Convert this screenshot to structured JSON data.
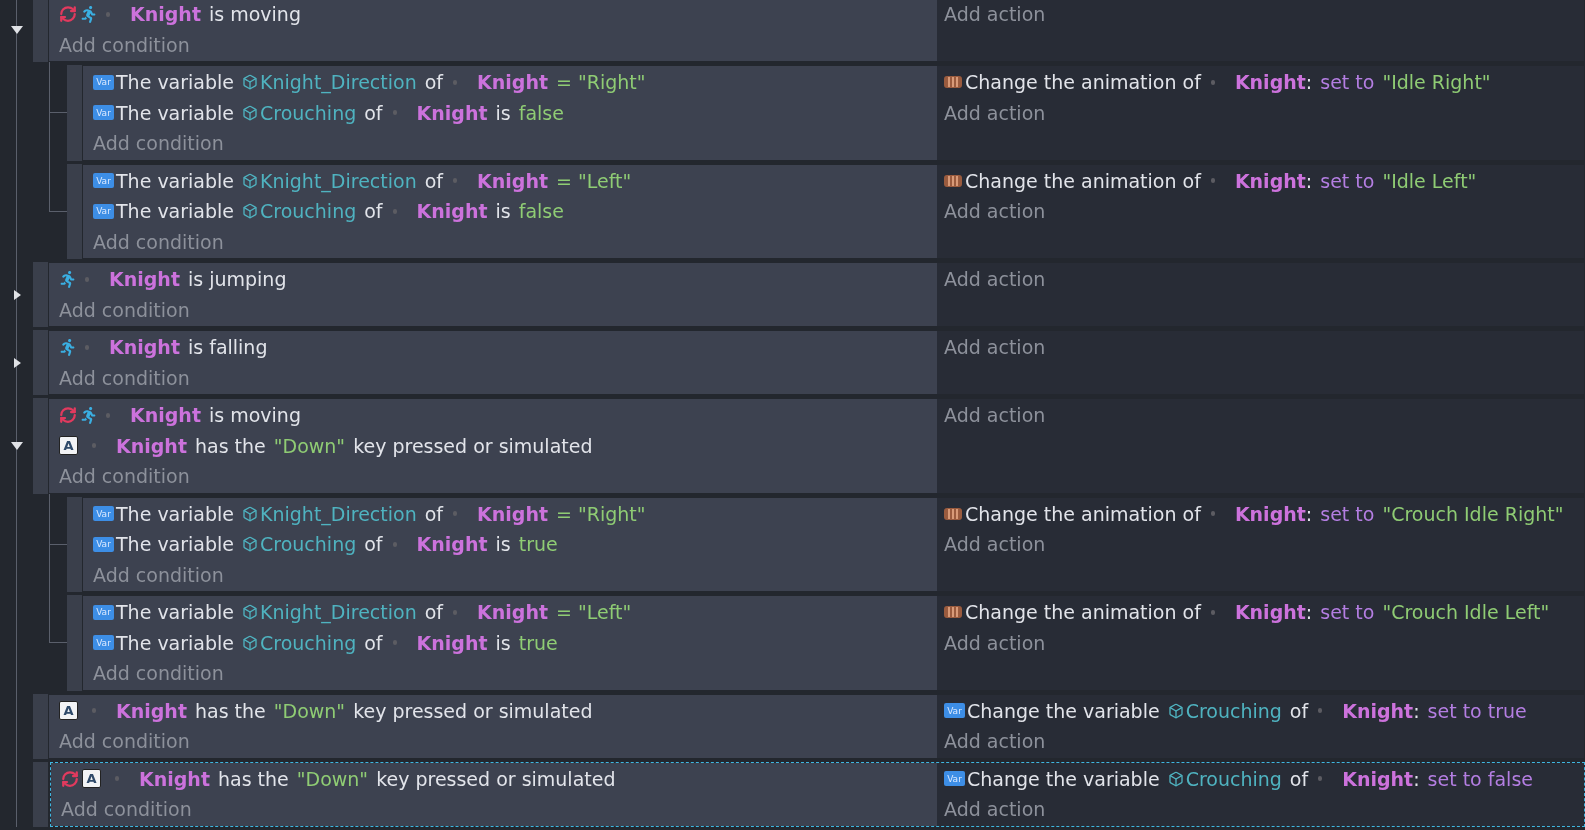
{
  "events": [
    {
      "expanded": true,
      "selected": false,
      "conditions": [
        {
          "icons": [
            {
              "kind": "invert"
            },
            {
              "kind": "run"
            }
          ],
          "parts": [
            {
              "kind": "object",
              "text": "Knight"
            },
            {
              "kind": "text",
              "text": "is moving"
            }
          ]
        }
      ],
      "add_condition": "Add condition",
      "add_action": "Add action",
      "children": [
        {
          "selected": false,
          "conditions": [
            {
              "icons": [
                {
                  "kind": "var",
                  "glyph": "Var"
                }
              ],
              "parts": [
                {
                  "kind": "text",
                  "text": "The variable"
                },
                {
                  "kind": "variable",
                  "text": "Knight_Direction"
                },
                {
                  "kind": "text",
                  "text": "of"
                },
                {
                  "kind": "object",
                  "text": "Knight"
                },
                {
                  "kind": "value",
                  "text": "= \"Right\""
                }
              ]
            },
            {
              "icons": [
                {
                  "kind": "var",
                  "glyph": "Var"
                }
              ],
              "parts": [
                {
                  "kind": "text",
                  "text": "The variable"
                },
                {
                  "kind": "variable",
                  "text": "Crouching"
                },
                {
                  "kind": "text",
                  "text": "of"
                },
                {
                  "kind": "object",
                  "text": "Knight"
                },
                {
                  "kind": "text",
                  "text": "is"
                },
                {
                  "kind": "value",
                  "text": "false"
                }
              ]
            }
          ],
          "add_condition": "Add condition",
          "actions": [
            {
              "icons": [
                {
                  "kind": "film"
                }
              ],
              "parts": [
                {
                  "kind": "text",
                  "text": "Change the animation of"
                },
                {
                  "kind": "object",
                  "text": "Knight"
                },
                {
                  "kind": "punct",
                  "text": ":"
                },
                {
                  "kind": "set",
                  "text": "set to"
                },
                {
                  "kind": "value",
                  "text": "\"Idle Right\""
                }
              ]
            }
          ],
          "add_action": "Add action"
        },
        {
          "selected": false,
          "conditions": [
            {
              "icons": [
                {
                  "kind": "var",
                  "glyph": "Var"
                }
              ],
              "parts": [
                {
                  "kind": "text",
                  "text": "The variable"
                },
                {
                  "kind": "variable",
                  "text": "Knight_Direction"
                },
                {
                  "kind": "text",
                  "text": "of"
                },
                {
                  "kind": "object",
                  "text": "Knight"
                },
                {
                  "kind": "value",
                  "text": "= \"Left\""
                }
              ]
            },
            {
              "icons": [
                {
                  "kind": "var",
                  "glyph": "Var"
                }
              ],
              "parts": [
                {
                  "kind": "text",
                  "text": "The variable"
                },
                {
                  "kind": "variable",
                  "text": "Crouching"
                },
                {
                  "kind": "text",
                  "text": "of"
                },
                {
                  "kind": "object",
                  "text": "Knight"
                },
                {
                  "kind": "text",
                  "text": "is"
                },
                {
                  "kind": "value",
                  "text": "false"
                }
              ]
            }
          ],
          "add_condition": "Add condition",
          "actions": [
            {
              "icons": [
                {
                  "kind": "film"
                }
              ],
              "parts": [
                {
                  "kind": "text",
                  "text": "Change the animation of"
                },
                {
                  "kind": "object",
                  "text": "Knight"
                },
                {
                  "kind": "punct",
                  "text": ":"
                },
                {
                  "kind": "set",
                  "text": "set to"
                },
                {
                  "kind": "value",
                  "text": "\"Idle Left\""
                }
              ]
            }
          ],
          "add_action": "Add action"
        }
      ]
    },
    {
      "expanded": false,
      "selected": false,
      "conditions": [
        {
          "icons": [
            {
              "kind": "run"
            }
          ],
          "parts": [
            {
              "kind": "object",
              "text": "Knight"
            },
            {
              "kind": "text",
              "text": "is jumping"
            }
          ]
        }
      ],
      "add_condition": "Add condition",
      "add_action": "Add action"
    },
    {
      "expanded": false,
      "selected": false,
      "conditions": [
        {
          "icons": [
            {
              "kind": "run"
            }
          ],
          "parts": [
            {
              "kind": "object",
              "text": "Knight"
            },
            {
              "kind": "text",
              "text": "is falling"
            }
          ]
        }
      ],
      "add_condition": "Add condition",
      "add_action": "Add action"
    },
    {
      "expanded": true,
      "selected": false,
      "conditions": [
        {
          "icons": [
            {
              "kind": "invert"
            },
            {
              "kind": "run"
            }
          ],
          "parts": [
            {
              "kind": "object",
              "text": "Knight"
            },
            {
              "kind": "text",
              "text": "is moving"
            }
          ]
        },
        {
          "icons": [
            {
              "kind": "key",
              "glyph": "A"
            }
          ],
          "parts": [
            {
              "kind": "object",
              "text": "Knight"
            },
            {
              "kind": "text",
              "text": "has the"
            },
            {
              "kind": "value",
              "text": "\"Down\""
            },
            {
              "kind": "text",
              "text": "key pressed or simulated"
            }
          ]
        }
      ],
      "add_condition": "Add condition",
      "add_action": "Add action",
      "children": [
        {
          "selected": false,
          "conditions": [
            {
              "icons": [
                {
                  "kind": "var",
                  "glyph": "Var"
                }
              ],
              "parts": [
                {
                  "kind": "text",
                  "text": "The variable"
                },
                {
                  "kind": "variable",
                  "text": "Knight_Direction"
                },
                {
                  "kind": "text",
                  "text": "of"
                },
                {
                  "kind": "object",
                  "text": "Knight"
                },
                {
                  "kind": "value",
                  "text": "= \"Right\""
                }
              ]
            },
            {
              "icons": [
                {
                  "kind": "var",
                  "glyph": "Var"
                }
              ],
              "parts": [
                {
                  "kind": "text",
                  "text": "The variable"
                },
                {
                  "kind": "variable",
                  "text": "Crouching"
                },
                {
                  "kind": "text",
                  "text": "of"
                },
                {
                  "kind": "object",
                  "text": "Knight"
                },
                {
                  "kind": "text",
                  "text": "is"
                },
                {
                  "kind": "value",
                  "text": "true"
                }
              ]
            }
          ],
          "add_condition": "Add condition",
          "actions": [
            {
              "icons": [
                {
                  "kind": "film"
                }
              ],
              "parts": [
                {
                  "kind": "text",
                  "text": "Change the animation of"
                },
                {
                  "kind": "object",
                  "text": "Knight"
                },
                {
                  "kind": "punct",
                  "text": ":"
                },
                {
                  "kind": "set",
                  "text": "set to"
                },
                {
                  "kind": "value",
                  "text": "\"Crouch Idle Right\""
                }
              ]
            }
          ],
          "add_action": "Add action"
        },
        {
          "selected": false,
          "conditions": [
            {
              "icons": [
                {
                  "kind": "var",
                  "glyph": "Var"
                }
              ],
              "parts": [
                {
                  "kind": "text",
                  "text": "The variable"
                },
                {
                  "kind": "variable",
                  "text": "Knight_Direction"
                },
                {
                  "kind": "text",
                  "text": "of"
                },
                {
                  "kind": "object",
                  "text": "Knight"
                },
                {
                  "kind": "value",
                  "text": "= \"Left\""
                }
              ]
            },
            {
              "icons": [
                {
                  "kind": "var",
                  "glyph": "Var"
                }
              ],
              "parts": [
                {
                  "kind": "text",
                  "text": "The variable"
                },
                {
                  "kind": "variable",
                  "text": "Crouching"
                },
                {
                  "kind": "text",
                  "text": "of"
                },
                {
                  "kind": "object",
                  "text": "Knight"
                },
                {
                  "kind": "text",
                  "text": "is"
                },
                {
                  "kind": "value",
                  "text": "true"
                }
              ]
            }
          ],
          "add_condition": "Add condition",
          "actions": [
            {
              "icons": [
                {
                  "kind": "film"
                }
              ],
              "parts": [
                {
                  "kind": "text",
                  "text": "Change the animation of"
                },
                {
                  "kind": "object",
                  "text": "Knight"
                },
                {
                  "kind": "punct",
                  "text": ":"
                },
                {
                  "kind": "set",
                  "text": "set to"
                },
                {
                  "kind": "value",
                  "text": "\"Crouch Idle Left\""
                }
              ]
            }
          ],
          "add_action": "Add action"
        }
      ]
    },
    {
      "selected": false,
      "conditions": [
        {
          "icons": [
            {
              "kind": "key",
              "glyph": "A"
            }
          ],
          "parts": [
            {
              "kind": "object",
              "text": "Knight"
            },
            {
              "kind": "text",
              "text": "has the"
            },
            {
              "kind": "value",
              "text": "\"Down\""
            },
            {
              "kind": "text",
              "text": "key pressed or simulated"
            }
          ]
        }
      ],
      "add_condition": "Add condition",
      "actions": [
        {
          "icons": [
            {
              "kind": "var",
              "glyph": "Var"
            }
          ],
          "parts": [
            {
              "kind": "text",
              "text": "Change the variable"
            },
            {
              "kind": "variable",
              "text": "Crouching"
            },
            {
              "kind": "text",
              "text": "of"
            },
            {
              "kind": "object",
              "text": "Knight"
            },
            {
              "kind": "punct",
              "text": ":"
            },
            {
              "kind": "set",
              "text": "set to true"
            }
          ]
        }
      ],
      "add_action": "Add action"
    },
    {
      "selected": true,
      "conditions": [
        {
          "icons": [
            {
              "kind": "invert"
            },
            {
              "kind": "key",
              "glyph": "A"
            }
          ],
          "parts": [
            {
              "kind": "object",
              "text": "Knight"
            },
            {
              "kind": "text",
              "text": "has the"
            },
            {
              "kind": "value",
              "text": "\"Down\""
            },
            {
              "kind": "text",
              "text": "key pressed or simulated"
            }
          ]
        }
      ],
      "add_condition": "Add condition",
      "actions": [
        {
          "icons": [
            {
              "kind": "var",
              "glyph": "Var"
            }
          ],
          "parts": [
            {
              "kind": "text",
              "text": "Change the variable"
            },
            {
              "kind": "variable",
              "text": "Crouching"
            },
            {
              "kind": "text",
              "text": "of"
            },
            {
              "kind": "object",
              "text": "Knight"
            },
            {
              "kind": "punct",
              "text": ":"
            },
            {
              "kind": "set",
              "text": "set to false"
            }
          ]
        }
      ],
      "add_action": "Add action"
    }
  ]
}
